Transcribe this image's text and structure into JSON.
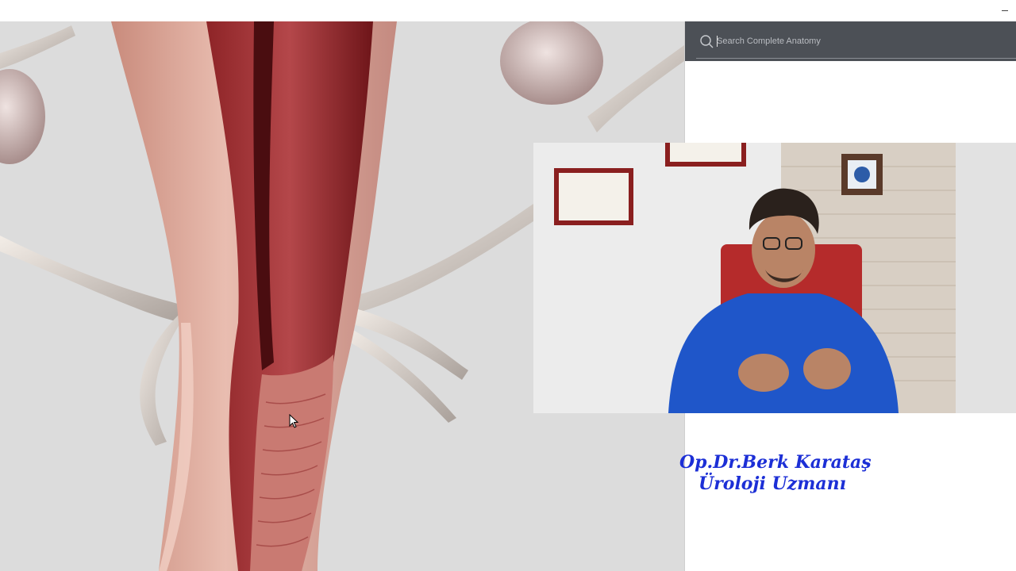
{
  "window": {
    "minimize_glyph": "–"
  },
  "search": {
    "placeholder": "Search Complete Anatomy",
    "value": ""
  },
  "viewport": {
    "content": "3d-anatomy-model"
  },
  "video_overlay": {
    "content": "presenter-webcam"
  },
  "caption": {
    "name": "Op.Dr.Berk Karataş",
    "title": "Üroloji Uzmanı"
  },
  "colors": {
    "search_bar": "#4c5056",
    "caption": "#1c2fd6",
    "tissue_dark": "#7a1b1f",
    "tissue_light": "#e8b5a8",
    "scrubs": "#1f56c9"
  },
  "icons": {
    "search": "search-icon",
    "cursor": "mouse-cursor-icon"
  }
}
